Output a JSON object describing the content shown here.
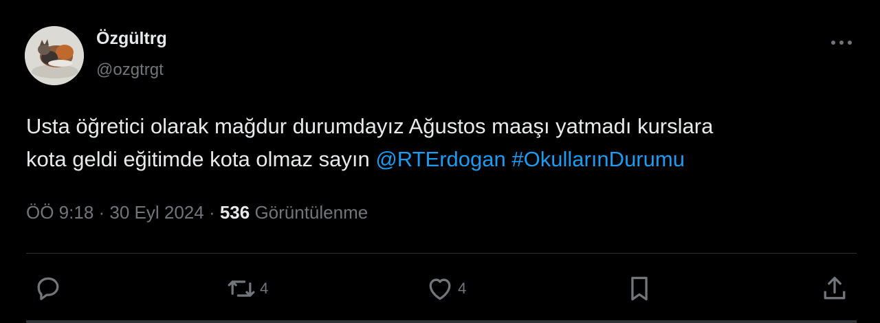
{
  "author": {
    "display_name": "Özgültrg",
    "handle": "@ozgtrgt"
  },
  "tweet": {
    "text_line1": "Usta öğretici olarak mağdur durumdayız Ağustos maaşı yatmadı kurslara",
    "text_line2_prefix": "kota geldi eğitimde kota olmaz sayın ",
    "mention": "@RTErdogan",
    "space": " ",
    "hashtag": "#OkullarınDurumu"
  },
  "meta": {
    "time": "ÖÖ 9:18",
    "separator1": " · ",
    "date": "30 Eyl 2024",
    "separator2": " · ",
    "views_count": "536",
    "views_label": " Görüntülenme"
  },
  "actions": {
    "reply_icon": "reply-icon",
    "retweet_icon": "retweet-icon",
    "retweet_count": "4",
    "like_icon": "heart-icon",
    "like_count": "4",
    "bookmark_icon": "bookmark-icon",
    "share_icon": "share-icon"
  },
  "colors": {
    "background": "#000000",
    "text": "#e7e9ea",
    "secondary": "#71767b",
    "link": "#1d9bf0",
    "divider": "#2f3336"
  }
}
